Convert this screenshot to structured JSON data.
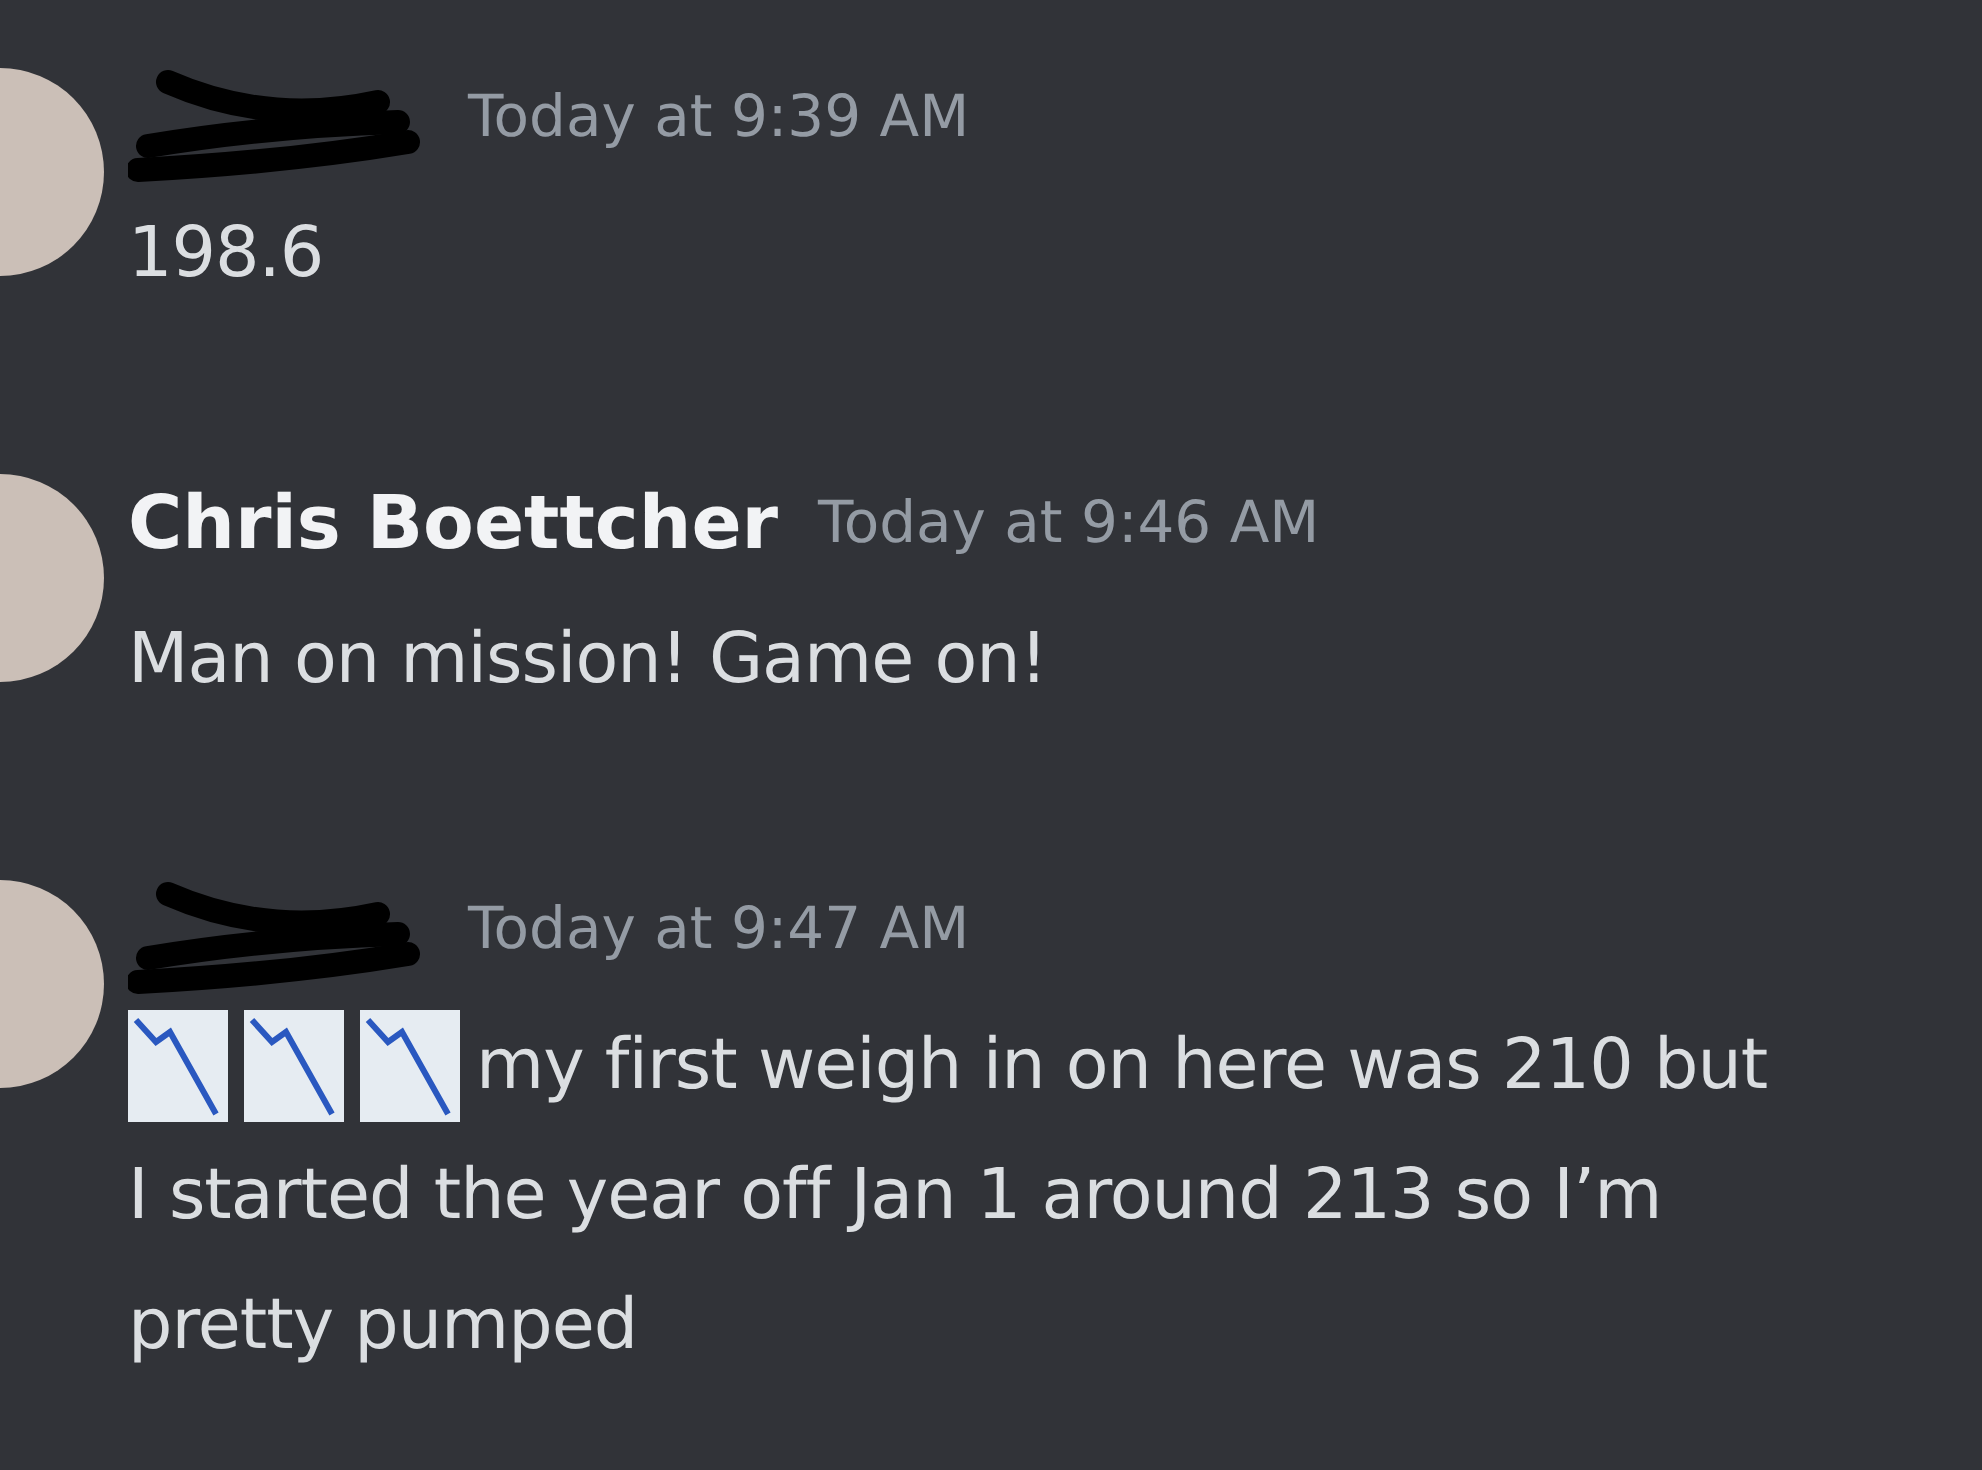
{
  "messages": [
    {
      "author": {
        "redacted": true
      },
      "timestamp": "Today at 9:39 AM",
      "lines": [
        {
          "kind": "text",
          "text": "198.6"
        }
      ]
    },
    {
      "author": {
        "redacted": false,
        "name": "Chris Boettcher"
      },
      "timestamp": "Today at 9:46 AM",
      "lines": [
        {
          "kind": "text",
          "text": "Man on mission! Game on!"
        }
      ]
    },
    {
      "author": {
        "redacted": true
      },
      "timestamp": "Today at 9:47 AM",
      "lines": [
        {
          "kind": "icons-and-text",
          "text": "my first weigh in on here was 210 but"
        },
        {
          "kind": "text",
          "text": "I started the year off Jan 1 around 213 so I’m"
        },
        {
          "kind": "text",
          "text": "pretty pumped"
        }
      ]
    }
  ]
}
